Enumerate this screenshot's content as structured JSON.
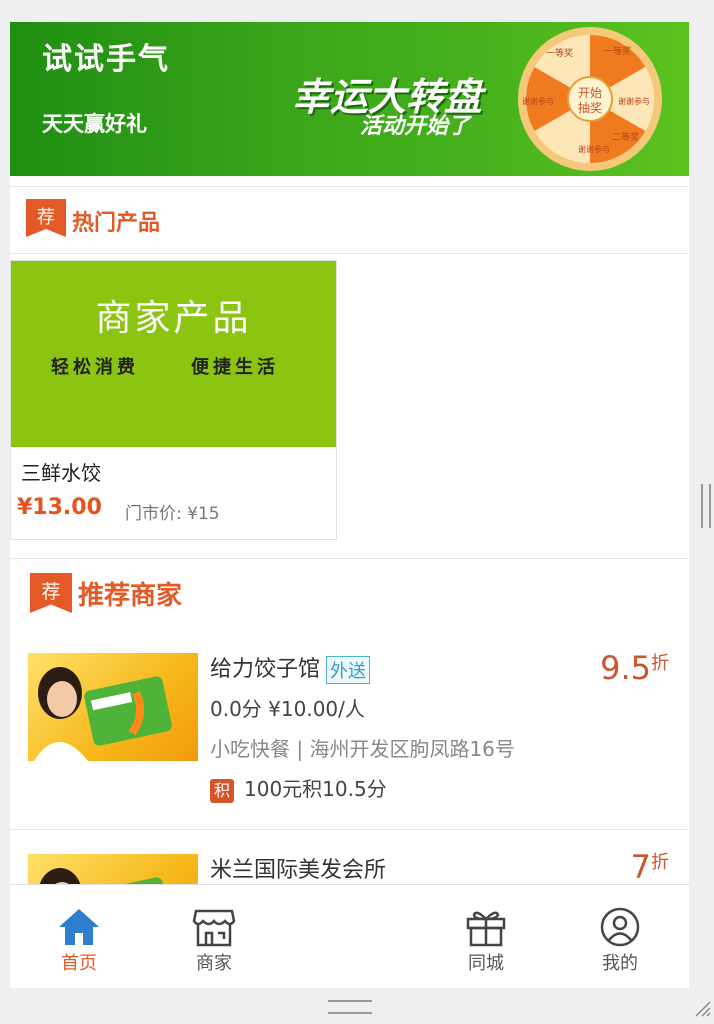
{
  "banner": {
    "line1": "试试手气",
    "line2": "天天赢好礼",
    "headline": "幸运大转盘",
    "subline": "活动开始了",
    "wheel_center": [
      "开始",
      "抽奖"
    ],
    "wheel_labels": [
      "一等奖",
      "谢谢参与",
      "谢谢参与",
      "谢谢参与",
      "一等奖",
      "二等奖"
    ]
  },
  "hot_section": {
    "tag": "荐",
    "title": "热门产品"
  },
  "product": {
    "image_heading": "商家产品",
    "image_slogan_left": "轻松消费",
    "image_slogan_right": "便捷生活",
    "name": "三鲜水饺",
    "price": "¥13.00",
    "original_price": "门市价: ¥15"
  },
  "merchant_section": {
    "tag": "荐",
    "title": "推荐商家"
  },
  "merchants": [
    {
      "name": "给力饺子馆",
      "badge": "外送",
      "rating_price": "0.0分 ¥10.00/人",
      "category_address": "小吃快餐 | 海州开发区朐凤路16号",
      "points_icon": "积",
      "points_text": "100元积10.5分",
      "discount": "9.5",
      "discount_unit": "折"
    },
    {
      "name": "米兰国际美发会所",
      "discount": "7",
      "discount_unit": "折"
    }
  ],
  "tabbar": {
    "items": [
      {
        "label": "首页",
        "icon": "home-icon",
        "active": true
      },
      {
        "label": "商家",
        "icon": "store-icon",
        "active": false
      },
      {
        "label": "同城",
        "icon": "gift-icon",
        "active": false
      },
      {
        "label": "我的",
        "icon": "user-icon",
        "active": false
      }
    ]
  },
  "colors": {
    "accent": "#e35a27",
    "banner_green": "#3aa51a",
    "product_green": "#8cc412",
    "active_tab_icon": "#2f7fd0"
  }
}
